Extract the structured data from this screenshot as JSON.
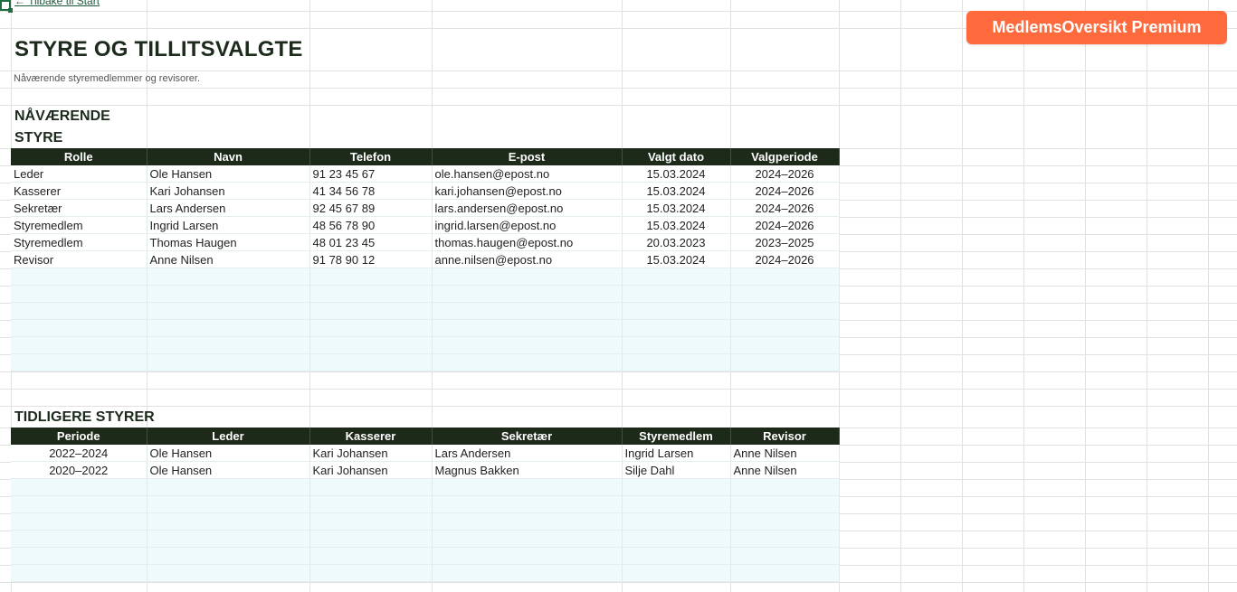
{
  "back_link": "← Tilbake til Start",
  "title": "STYRE OG TILLITSVALGTE",
  "subtitle": "Nåværende styremedlemmer og revisorer.",
  "premium_button": "MedlemsOversikt Premium",
  "current_board": {
    "heading_line1": "NÅVÆRENDE",
    "heading_line2": "STYRE",
    "columns": [
      "Rolle",
      "Navn",
      "Telefon",
      "E-post",
      "Valgt dato",
      "Valgperiode"
    ],
    "rows": [
      [
        "Leder",
        "Ole Hansen",
        "91 23 45 67",
        "ole.hansen@epost.no",
        "15.03.2024",
        "2024–2026"
      ],
      [
        "Kasserer",
        "Kari Johansen",
        "41 34 56 78",
        "kari.johansen@epost.no",
        "15.03.2024",
        "2024–2026"
      ],
      [
        "Sekretær",
        "Lars Andersen",
        "92 45 67 89",
        "lars.andersen@epost.no",
        "15.03.2024",
        "2024–2026"
      ],
      [
        "Styremedlem",
        "Ingrid Larsen",
        "48 56 78 90",
        "ingrid.larsen@epost.no",
        "15.03.2024",
        "2024–2026"
      ],
      [
        "Styremedlem",
        "Thomas Haugen",
        "48 01 23 45",
        "thomas.haugen@epost.no",
        "20.03.2023",
        "2023–2025"
      ],
      [
        "Revisor",
        "Anne Nilsen",
        "91 78 90 12",
        "anne.nilsen@epost.no",
        "15.03.2024",
        "2024–2026"
      ]
    ]
  },
  "previous_boards": {
    "heading": "TIDLIGERE STYRER",
    "columns": [
      "Periode",
      "Leder",
      "Kasserer",
      "Sekretær",
      "Styremedlem",
      "Revisor"
    ],
    "rows": [
      [
        "2022–2024",
        "Ole Hansen",
        "Kari Johansen",
        "Lars Andersen",
        "Ingrid Larsen",
        "Anne Nilsen"
      ],
      [
        "2020–2022",
        "Ole Hansen",
        "Kari Johansen",
        "Magnus Bakken",
        "Silje Dahl",
        "Anne Nilsen"
      ]
    ]
  },
  "colors": {
    "header_bg": "#1d2a1a",
    "empty_row_bg": "#eefafc",
    "premium_bg": "#ff6a3d"
  }
}
